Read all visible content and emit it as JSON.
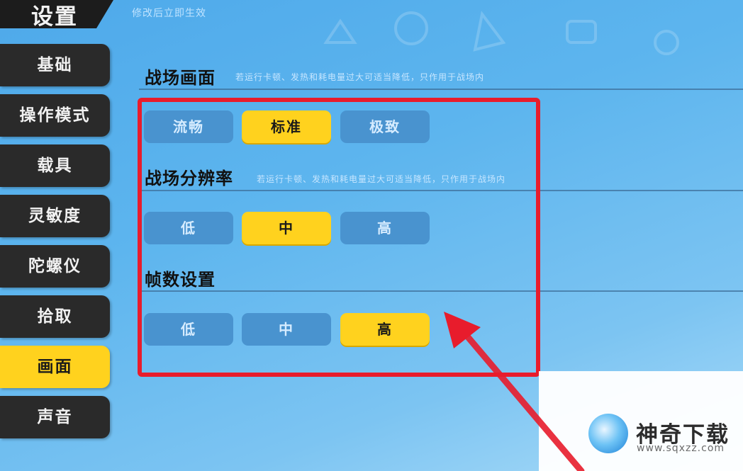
{
  "header": {
    "title": "设置",
    "subtitle": "修改后立即生效"
  },
  "sidebar": {
    "items": [
      {
        "label": "基础",
        "active": false
      },
      {
        "label": "操作模式",
        "active": false
      },
      {
        "label": "载具",
        "active": false
      },
      {
        "label": "灵敏度",
        "active": false
      },
      {
        "label": "陀螺仪",
        "active": false
      },
      {
        "label": "拾取",
        "active": false
      },
      {
        "label": "画面",
        "active": true
      },
      {
        "label": "声音",
        "active": false
      }
    ]
  },
  "sections": [
    {
      "title": "战场画面",
      "description": "若运行卡顿、发热和耗电量过大可适当降低，只作用于战场内",
      "options": [
        {
          "label": "流畅",
          "selected": false
        },
        {
          "label": "标准",
          "selected": true
        },
        {
          "label": "极致",
          "selected": false
        }
      ]
    },
    {
      "title": "战场分辨率",
      "description": "若运行卡顿、发热和耗电量过大可适当降低，只作用于战场内",
      "options": [
        {
          "label": "低",
          "selected": false
        },
        {
          "label": "中",
          "selected": true
        },
        {
          "label": "高",
          "selected": false
        }
      ]
    },
    {
      "title": "帧数设置",
      "description": "",
      "options": [
        {
          "label": "低",
          "selected": false
        },
        {
          "label": "中",
          "selected": false
        },
        {
          "label": "高",
          "selected": true
        }
      ]
    }
  ],
  "watermark": {
    "name": "神奇下载",
    "url": "www.sqxzz.com"
  },
  "colors": {
    "accent": "#ffd21e",
    "highlight": "#e81c2c",
    "nav_bg": "#2a2a2a",
    "option_bg": "#4993cf"
  }
}
